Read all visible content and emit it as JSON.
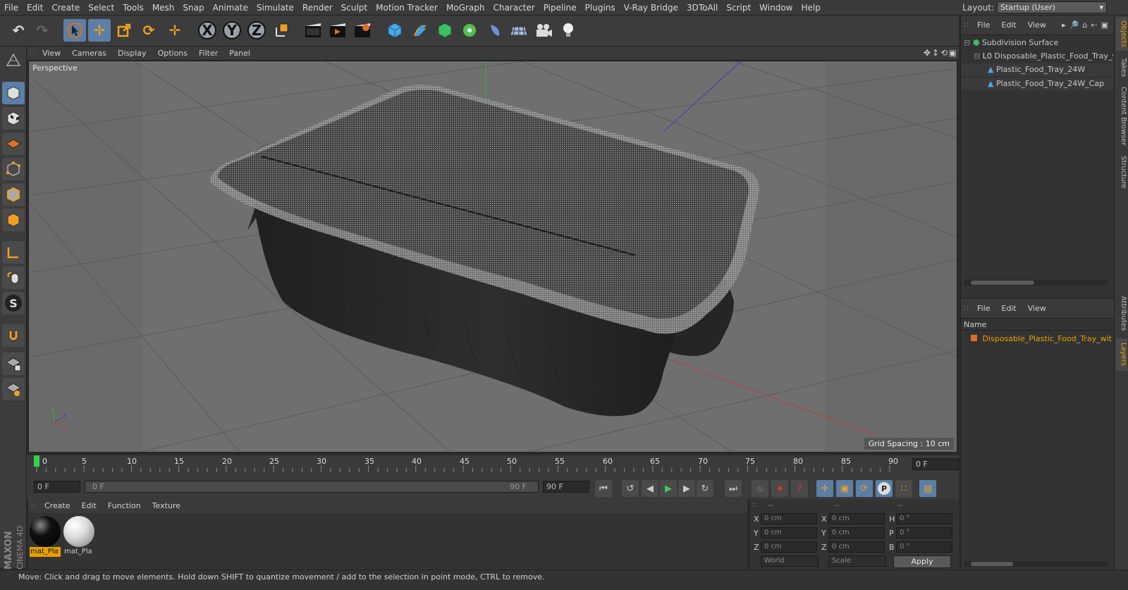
{
  "menubar": {
    "items": [
      "File",
      "Edit",
      "Create",
      "Select",
      "Tools",
      "Mesh",
      "Snap",
      "Animate",
      "Simulate",
      "Render",
      "Sculpt",
      "Motion Tracker",
      "MoGraph",
      "Character",
      "Pipeline",
      "Plugins",
      "V-Ray Bridge",
      "3DToAll",
      "Script",
      "Window",
      "Help"
    ],
    "layout_label": "Layout:",
    "layout_value": "Startup (User)"
  },
  "toolbar": {
    "axis_x": "X",
    "axis_y": "Y",
    "axis_z": "Z"
  },
  "viewport": {
    "menu": [
      "View",
      "Cameras",
      "Display",
      "Options",
      "Filter",
      "Panel"
    ],
    "label": "Perspective",
    "grid_spacing": "Grid Spacing : 10 cm"
  },
  "timeline": {
    "ticks": [
      "0",
      "5",
      "10",
      "15",
      "20",
      "25",
      "30",
      "35",
      "40",
      "45",
      "50",
      "55",
      "60",
      "65",
      "70",
      "75",
      "80",
      "85",
      "90"
    ],
    "current_frame": "0 F"
  },
  "transport": {
    "start_frame": "0 F",
    "range_start": "0 F",
    "range_end": "90 F",
    "end_frame": "90 F"
  },
  "materials": {
    "menu": [
      "Create",
      "Edit",
      "Function",
      "Texture"
    ],
    "items": [
      {
        "label": "mat_Pla",
        "color": "#111111"
      },
      {
        "label": "mat_Pla",
        "color": "#e8e8e8"
      }
    ]
  },
  "coords": {
    "headers": [
      "--",
      "--",
      "--"
    ],
    "rows": [
      {
        "a": "X",
        "av": "0 cm",
        "b": "X",
        "bv": "0 cm",
        "c": "H",
        "cv": "0 °"
      },
      {
        "a": "Y",
        "av": "0 cm",
        "b": "Y",
        "bv": "0 cm",
        "c": "P",
        "cv": "0 °"
      },
      {
        "a": "Z",
        "av": "0 cm",
        "b": "Z",
        "bv": "0 cm",
        "c": "B",
        "cv": "0 °"
      }
    ],
    "space": "World",
    "mode": "Scale",
    "apply": "Apply"
  },
  "objects": {
    "menu": [
      "File",
      "Edit",
      "View"
    ],
    "items": [
      {
        "label": "Subdivision Surface",
        "indent": 0
      },
      {
        "label": "Disposable_Plastic_Food_Tray_w",
        "indent": 1
      },
      {
        "label": "Plastic_Food_Tray_24W",
        "indent": 2
      },
      {
        "label": "Plastic_Food_Tray_24W_Cap",
        "indent": 2
      }
    ]
  },
  "layers": {
    "menu": [
      "File",
      "Edit",
      "View"
    ],
    "column": "Name",
    "item": "Disposable_Plastic_Food_Tray_wit"
  },
  "right_tabs": [
    "Objects",
    "Takes",
    "Content Browser",
    "Structure",
    "Attributes",
    "Layers"
  ],
  "status": "Move: Click and drag to move elements. Hold down SHIFT to quantize movement / add to the selection in point mode, CTRL to remove.",
  "brand": {
    "line1": "MAXON",
    "line2": "CINEMA 4D"
  },
  "colors": {
    "accent": "#5b7fa6",
    "highlight": "#e8a000",
    "viewport_bg": "#6f6f6f"
  }
}
